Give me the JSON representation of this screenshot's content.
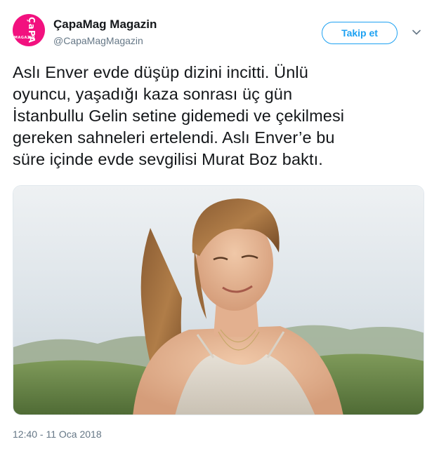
{
  "account": {
    "display_name": "ÇapaMag Magazin",
    "handle": "@CapaMagMagazin",
    "avatar_text": "ÇaPA",
    "avatar_subtext": "MAGAZIN",
    "avatar_color": "#f2117f"
  },
  "actions": {
    "follow_label": "Takip et",
    "menu_icon": "chevron-down-icon"
  },
  "tweet": {
    "text": "Aslı Enver evde düşüp dizini incitti. Ünlü\noyuncu, yaşadığı kaza sonrası üç gün\nİstanbullu Gelin setine gidemedi ve çekilmesi\ngereken sahneleri ertelendi. Aslı Enver’e bu\nsüre içinde evde sevgilisi Murat Boz baktı.",
    "timestamp": "12:40 - 11 Oca 2018"
  },
  "colors": {
    "accent": "#1da1f2",
    "secondary_text": "#657786"
  }
}
